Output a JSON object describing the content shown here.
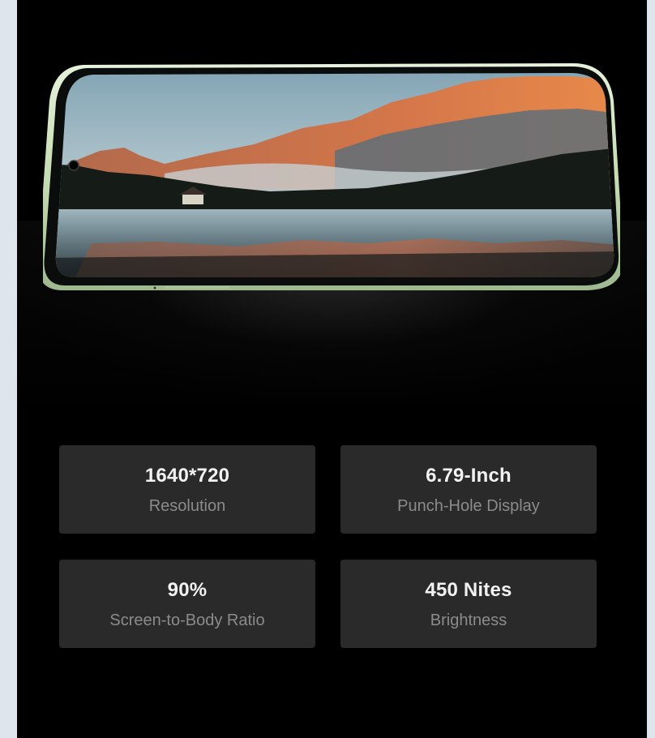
{
  "colors": {
    "page_bg": "#dfe5ec",
    "panel_bg": "#000000",
    "card_bg": "#2a2a2a",
    "value_text": "#f2f2f2",
    "label_text": "#8b8b8b",
    "phone_frame": "#c9dfb8"
  },
  "hero": {
    "image": "smartphone-landscape-mountain-lake-photo"
  },
  "specs": [
    {
      "value": "1640*720",
      "label": "Resolution"
    },
    {
      "value": "6.79-Inch",
      "label": "Punch-Hole Display"
    },
    {
      "value": "90%",
      "label": "Screen-to-Body Ratio"
    },
    {
      "value": "450 Nites",
      "label": "Brightness"
    }
  ]
}
